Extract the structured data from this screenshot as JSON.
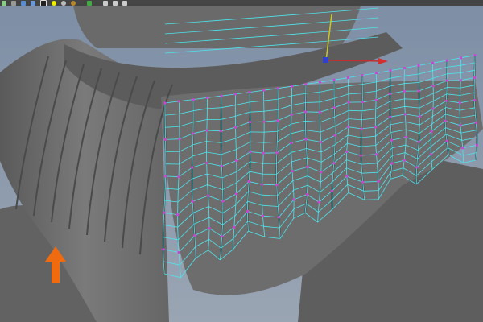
{
  "toolbar": {
    "icons": [
      "frame-icon",
      "wireframe-cube-icon",
      "smooth-shade-cube-icon",
      "wireframe-on-shaded-icon",
      "checker-icon",
      "default-light-icon",
      "all-lights-icon",
      "shadow-icon",
      "isolate-select-icon",
      "camera-icon",
      "resolution-gate-icon",
      "xray-icon"
    ]
  },
  "colors": {
    "background": "#8a98aa",
    "mesh": "#6e6e6e",
    "wire": "#4fe3ec",
    "vertex": "#d040d8",
    "arrow": "#f06a10"
  },
  "annotation": {
    "icon": "orange-arrow-up-icon"
  }
}
